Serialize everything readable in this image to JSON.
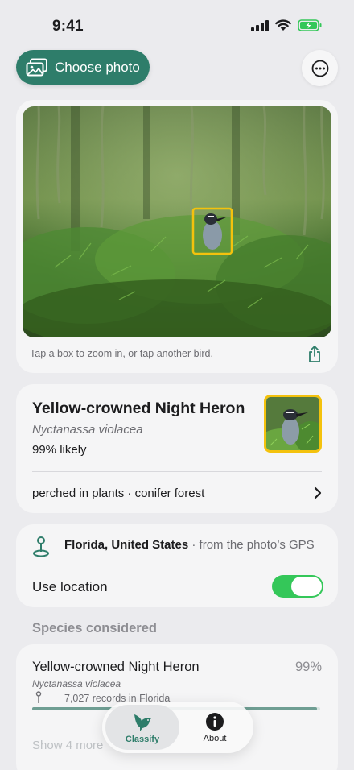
{
  "status": {
    "time": "9:41"
  },
  "toolbar": {
    "choose_photo": "Choose photo"
  },
  "photo_card": {
    "caption": "Tap a box to zoom in, or tap another bird."
  },
  "result": {
    "common_name": "Yellow-crowned Night Heron",
    "scientific_name": "Nyctanassa violacea",
    "likelihood": "99% likely",
    "habitat": "perched in plants · conifer forest"
  },
  "location": {
    "place": "Florida, United States",
    "source": " · from the photo’s GPS",
    "use_location_label": "Use location",
    "use_location_on": true
  },
  "species": {
    "title": "Species considered",
    "items": [
      {
        "name": "Yellow-crowned Night Heron",
        "percent": "99%",
        "scientific": "Nyctanassa violacea",
        "records": "7,027 records in Florida",
        "fraction": 0.99
      }
    ],
    "show_more": "Show 4 more"
  },
  "tabs": [
    {
      "label": "Classify",
      "icon": "hummingbird-icon",
      "selected": true
    },
    {
      "label": "About",
      "icon": "info-icon",
      "selected": false
    }
  ],
  "colors": {
    "accent": "#2e7d6a",
    "highlight": "#f4c20d",
    "toggle_on": "#34c759"
  }
}
